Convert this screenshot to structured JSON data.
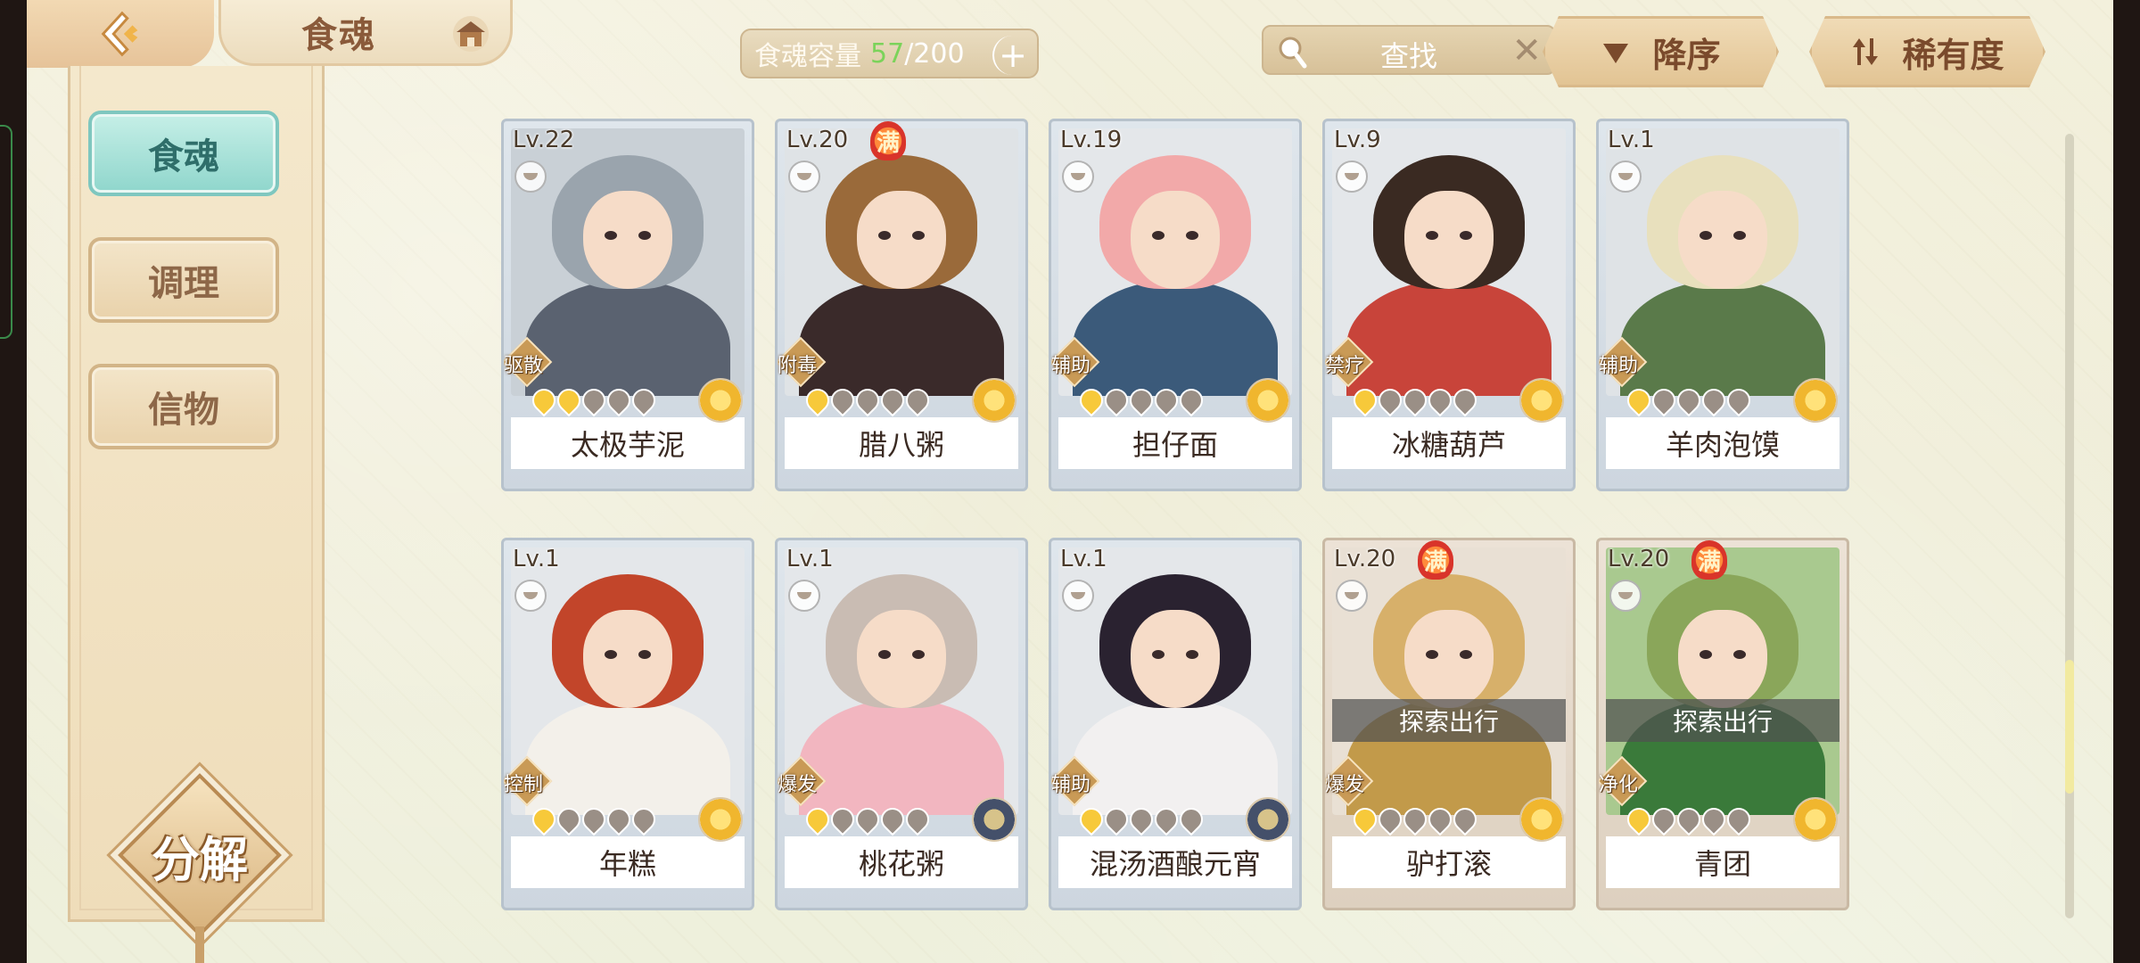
{
  "header": {
    "title": "食魂",
    "capacity_label": "食魂容量",
    "capacity_current": "57",
    "capacity_max": "/200",
    "capacity_add": "+",
    "search_placeholder": "查找",
    "search_clear": "✕",
    "sort_order_label": "降序",
    "sort_by_label": "稀有度"
  },
  "sidebar": {
    "items": [
      {
        "label": "食魂",
        "active": true
      },
      {
        "label": "调理",
        "active": false
      },
      {
        "label": "信物",
        "active": false
      }
    ],
    "decompose_label": "分解"
  },
  "cards": [
    {
      "name": "太极芋泥",
      "level": "Lv.22",
      "role": "驱散",
      "max": false,
      "stars": 2,
      "rarity": "gold",
      "explore": "",
      "hair": "#9aa4ad",
      "body": "#5a6270",
      "bg": "#c9d0d6"
    },
    {
      "name": "腊八粥",
      "level": "Lv.20",
      "role": "附毒",
      "max": true,
      "max_label": "满",
      "stars": 1,
      "rarity": "gold",
      "explore": "",
      "hair": "#9a6a3a",
      "body": "#3a2a2a",
      "bg": "#dfe3e6"
    },
    {
      "name": "担仔面",
      "level": "Lv.19",
      "role": "辅助",
      "max": false,
      "stars": 1,
      "rarity": "gold",
      "explore": "",
      "hair": "#f2a9a9",
      "body": "#3b5a7a",
      "bg": "#e4e7ea"
    },
    {
      "name": "冰糖葫芦",
      "level": "Lv.9",
      "role": "禁疗",
      "max": false,
      "stars": 1,
      "rarity": "gold",
      "explore": "",
      "hair": "#3a2a22",
      "body": "#c8443a",
      "bg": "#e4e7ea"
    },
    {
      "name": "羊肉泡馍",
      "level": "Lv.1",
      "role": "辅助",
      "max": false,
      "stars": 1,
      "rarity": "gold",
      "explore": "",
      "hair": "#e8e0bd",
      "body": "#5a7a4a",
      "bg": "#dfe3e6"
    },
    {
      "name": "年糕",
      "level": "Lv.1",
      "role": "控制",
      "max": false,
      "stars": 1,
      "rarity": "gold",
      "explore": "",
      "hair": "#c2452a",
      "body": "#f3f0ea",
      "bg": "#e4e7ea"
    },
    {
      "name": "桃花粥",
      "level": "Lv.1",
      "role": "爆发",
      "max": false,
      "stars": 1,
      "rarity": "blue",
      "explore": "",
      "hair": "#c9bcb3",
      "body": "#f2b6c0",
      "bg": "#e4e7ea"
    },
    {
      "name": "混汤酒酿元宵",
      "level": "Lv.1",
      "role": "辅助",
      "max": false,
      "stars": 1,
      "rarity": "blue",
      "explore": "",
      "hair": "#2a2230",
      "body": "#f2f0f0",
      "bg": "#e4e7ea"
    },
    {
      "name": "驴打滚",
      "level": "Lv.20",
      "role": "爆发",
      "max": true,
      "max_label": "满",
      "stars": 1,
      "rarity": "gold",
      "explore": "探索出行",
      "hair": "#d7b06a",
      "body": "#c29a4a",
      "bg": "#e9e0d4"
    },
    {
      "name": "青团",
      "level": "Lv.20",
      "role": "净化",
      "max": true,
      "max_label": "满",
      "stars": 1,
      "rarity": "gold",
      "explore": "探索出行",
      "hair": "#8aa65a",
      "body": "#3a7a3a",
      "bg": "#a9c98f"
    }
  ]
}
